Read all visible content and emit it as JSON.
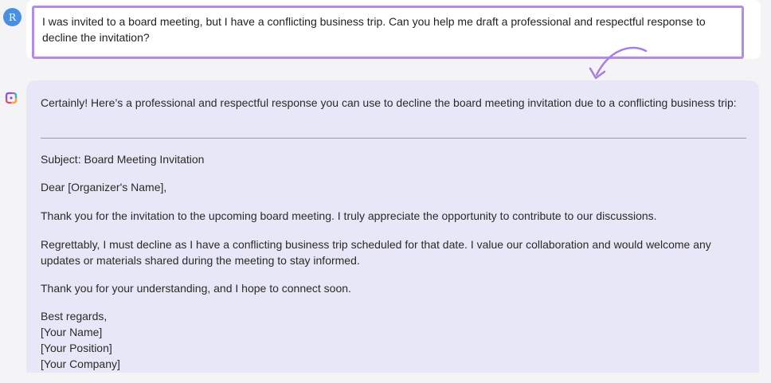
{
  "user": {
    "avatar_initial": "R",
    "message": "I was invited to a board meeting, but I have a conflicting business trip. Can you help me draft a professional and respectful response to decline the invitation?"
  },
  "assistant": {
    "intro": "Certainly! Here’s a professional and respectful response you can use to decline the board meeting invitation due to a conflicting business trip:",
    "subject": "Subject: Board Meeting Invitation",
    "greeting": "Dear [Organizer's Name],",
    "paragraph1": "Thank you for the invitation to the upcoming board meeting. I truly appreciate the opportunity to contribute to our discussions.",
    "paragraph2": "Regrettably, I must decline as I have a conflicting business trip scheduled for that date. I value our collaboration and would welcome any updates or materials shared during the meeting to stay informed.",
    "paragraph3": "Thank you for your understanding, and I hope to connect soon.",
    "signoff": "Best regards,",
    "signature": [
      "[Your Name]",
      "[Your Position]",
      "[Your Company]"
    ]
  },
  "colors": {
    "highlight_border": "#b48be6",
    "assistant_bubble": "#e8e7f7",
    "user_avatar": "#4a90e2",
    "arrow": "#a77fe0"
  },
  "icons": {
    "user_avatar": "avatar",
    "assistant": "assistant-logo-icon",
    "annotation": "curved-arrow-icon"
  }
}
